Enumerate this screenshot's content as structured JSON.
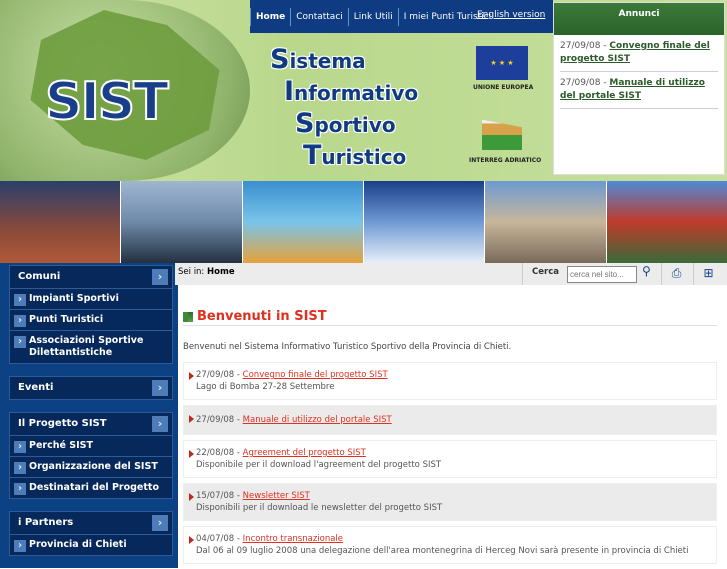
{
  "header": {
    "logo": "SIST",
    "title_words": [
      [
        "S",
        "istema"
      ],
      [
        "I",
        "nformativo"
      ],
      [
        "S",
        "portivo"
      ],
      [
        "T",
        "uristico"
      ]
    ],
    "eu_label": "UNIONE EUROPEA",
    "interreg_label": "INTERREG ADRIATICO"
  },
  "topnav": [
    "Home",
    "Contattaci",
    "Link Utili",
    "I miei Punti Turistici"
  ],
  "english": "English version",
  "annunci": {
    "title": "Annunci",
    "items": [
      {
        "date": "27/09/08",
        "link": "Convegno finale del progetto SIST"
      },
      {
        "date": "27/09/08",
        "link": "Manuale di utilizzo del portale SIST"
      }
    ]
  },
  "sidebar": [
    {
      "title": "Comuni",
      "items": [
        "Impianti Sportivi",
        "Punti Turistici",
        "Associazioni Sportive Dilettantistiche"
      ]
    },
    {
      "title": "Eventi",
      "items": []
    },
    {
      "title": "Il Progetto SIST",
      "items": [
        "Perché SIST",
        "Organizzazione del SIST",
        "Destinatari del Progetto"
      ]
    },
    {
      "title": "i Partners",
      "items": [
        "Provincia di Chieti"
      ]
    }
  ],
  "breadcrumb": {
    "label": "Sei in:",
    "current": "Home"
  },
  "search": {
    "label": "Cerca",
    "placeholder": "cerca nel sito..."
  },
  "main": {
    "title": "Benvenuti in SIST",
    "intro": "Benvenuti nel Sistema Informativo Turistico Sportivo della Provincia di Chieti.",
    "news": [
      {
        "date": "27/09/08",
        "link": "Convegno finale del progetto SIST",
        "desc": "Lago di Bomba 27-28 Settembre"
      },
      {
        "date": "27/09/08",
        "link": "Manuale di utilizzo del portale SIST",
        "desc": ""
      },
      {
        "date": "22/08/08",
        "link": "Agreement del progetto SIST",
        "desc": "Disponibile per il download l'agreement del progetto SIST"
      },
      {
        "date": "15/07/08",
        "link": "Newsletter SIST",
        "desc": "Disponibili per il download le newsletter del progetto SIST"
      },
      {
        "date": "04/07/08",
        "link": "Incontro transnazionale",
        "desc": "Dal 06 al 09 luglio 2008 una delegazione dell'area montenegrina di Herceg Novi sarà presente in provincia di Chieti"
      }
    ]
  }
}
